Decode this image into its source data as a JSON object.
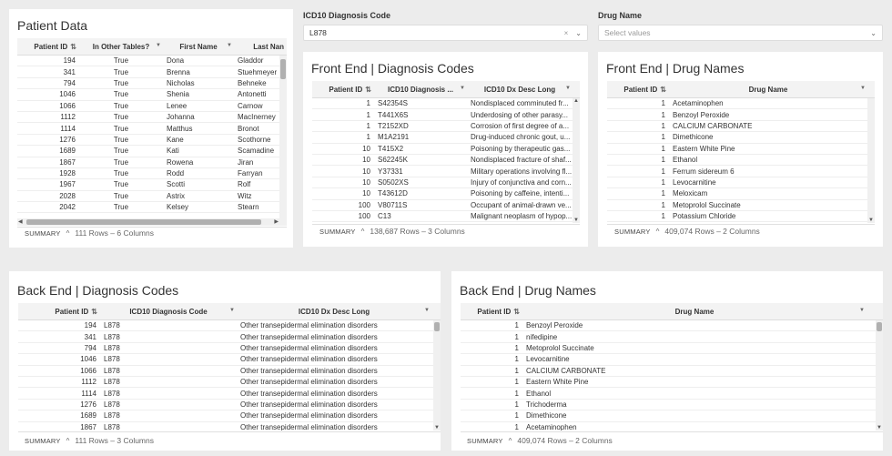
{
  "patient_data": {
    "title": "Patient Data",
    "columns": [
      "Patient ID",
      "In Other Tables?",
      "First Name",
      "Last Nan"
    ],
    "rows": [
      [
        "194",
        "True",
        "Dona",
        "Gladdor"
      ],
      [
        "341",
        "True",
        "Brenna",
        "Stuehmeyer"
      ],
      [
        "794",
        "True",
        "Nicholas",
        "Behneke"
      ],
      [
        "1046",
        "True",
        "Shenia",
        "Antonetti"
      ],
      [
        "1066",
        "True",
        "Lenee",
        "Carnow"
      ],
      [
        "1112",
        "True",
        "Johanna",
        "MacInerney"
      ],
      [
        "1114",
        "True",
        "Matthus",
        "Bronot"
      ],
      [
        "1276",
        "True",
        "Kane",
        "Scothorne"
      ],
      [
        "1689",
        "True",
        "Kati",
        "Scamadine"
      ],
      [
        "1867",
        "True",
        "Rowena",
        "Jiran"
      ],
      [
        "1928",
        "True",
        "Rodd",
        "Farryan"
      ],
      [
        "1967",
        "True",
        "Scotti",
        "Rolf"
      ],
      [
        "2028",
        "True",
        "Astrix",
        "Witz"
      ],
      [
        "2042",
        "True",
        "Kelsey",
        "Stearn"
      ]
    ],
    "summary_label": "SUMMARY",
    "summary_text": "111 Rows – 6 Columns"
  },
  "filters": {
    "icd_label": "ICD10 Diagnosis Code",
    "icd_value": "L878",
    "icd_clear": "×",
    "drug_label": "Drug Name",
    "drug_placeholder": "Select values",
    "chevron": "⌄"
  },
  "fe_diag": {
    "title": "Front End | Diagnosis Codes",
    "columns": [
      "Patient ID",
      "ICD10 Diagnosis ...",
      "ICD10 Dx Desc Long"
    ],
    "rows": [
      [
        "1",
        "S42354S",
        "Nondisplaced comminuted fr..."
      ],
      [
        "1",
        "T441X6S",
        "Underdosing of other parasy..."
      ],
      [
        "1",
        "T2152XD",
        "Corrosion of first degree of a..."
      ],
      [
        "1",
        "M1A2191",
        "Drug-induced chronic gout, u..."
      ],
      [
        "10",
        "T415X2",
        "Poisoning by therapeutic gas..."
      ],
      [
        "10",
        "S62245K",
        "Nondisplaced fracture of shaf..."
      ],
      [
        "10",
        "Y37331",
        "Military operations involving fl..."
      ],
      [
        "10",
        "S0502XS",
        "Injury of conjunctiva and corn..."
      ],
      [
        "10",
        "T43612D",
        "Poisoning by caffeine, intenti..."
      ],
      [
        "100",
        "V80711S",
        "Occupant of animal-drawn ve..."
      ],
      [
        "100",
        "C13",
        "Malignant neoplasm of hypop..."
      ]
    ],
    "summary_label": "SUMMARY",
    "summary_text": "138,687 Rows – 3 Columns"
  },
  "fe_drug": {
    "title": "Front End | Drug Names",
    "columns": [
      "Patient ID",
      "Drug Name"
    ],
    "rows": [
      [
        "1",
        "Acetaminophen"
      ],
      [
        "1",
        "Benzoyl Peroxide"
      ],
      [
        "1",
        "CALCIUM CARBONATE"
      ],
      [
        "1",
        "Dimethicone"
      ],
      [
        "1",
        "Eastern White Pine"
      ],
      [
        "1",
        "Ethanol"
      ],
      [
        "1",
        "Ferrum sidereum 6"
      ],
      [
        "1",
        "Levocarnitine"
      ],
      [
        "1",
        "Meloxicam"
      ],
      [
        "1",
        "Metoprolol Succinate"
      ],
      [
        "1",
        "Potassium Chloride"
      ]
    ],
    "summary_label": "SUMMARY",
    "summary_text": "409,074 Rows – 2 Columns"
  },
  "be_diag": {
    "title": "Back End | Diagnosis Codes",
    "columns": [
      "Patient ID",
      "ICD10 Diagnosis Code",
      "ICD10 Dx Desc Long"
    ],
    "rows": [
      [
        "194",
        "L878",
        "Other transepidermal elimination disorders"
      ],
      [
        "341",
        "L878",
        "Other transepidermal elimination disorders"
      ],
      [
        "794",
        "L878",
        "Other transepidermal elimination disorders"
      ],
      [
        "1046",
        "L878",
        "Other transepidermal elimination disorders"
      ],
      [
        "1066",
        "L878",
        "Other transepidermal elimination disorders"
      ],
      [
        "1112",
        "L878",
        "Other transepidermal elimination disorders"
      ],
      [
        "1114",
        "L878",
        "Other transepidermal elimination disorders"
      ],
      [
        "1276",
        "L878",
        "Other transepidermal elimination disorders"
      ],
      [
        "1689",
        "L878",
        "Other transepidermal elimination disorders"
      ],
      [
        "1867",
        "L878",
        "Other transepidermal elimination disorders"
      ]
    ],
    "summary_label": "SUMMARY",
    "summary_text": "111 Rows – 3 Columns"
  },
  "be_drug": {
    "title": "Back End | Drug Names",
    "columns": [
      "Patient ID",
      "Drug Name"
    ],
    "rows": [
      [
        "1",
        "Benzoyl Peroxide"
      ],
      [
        "1",
        "nifedipine"
      ],
      [
        "1",
        "Metoprolol Succinate"
      ],
      [
        "1",
        "Levocarnitine"
      ],
      [
        "1",
        "CALCIUM CARBONATE"
      ],
      [
        "1",
        "Eastern White Pine"
      ],
      [
        "1",
        "Ethanol"
      ],
      [
        "1",
        "Trichoderma"
      ],
      [
        "1",
        "Dimethicone"
      ],
      [
        "1",
        "Acetaminophen"
      ]
    ],
    "summary_label": "SUMMARY",
    "summary_text": "409,074 Rows – 2 Columns"
  },
  "icons": {
    "sort": "sort-icon",
    "dropdown": "dropdown-icon",
    "caret": "caret-up-icon"
  },
  "glyphs": {
    "sort": "⇅",
    "dd": "▼",
    "caret": "^",
    "up": "▲",
    "dn": "▼",
    "left": "◀",
    "right": "▶"
  }
}
